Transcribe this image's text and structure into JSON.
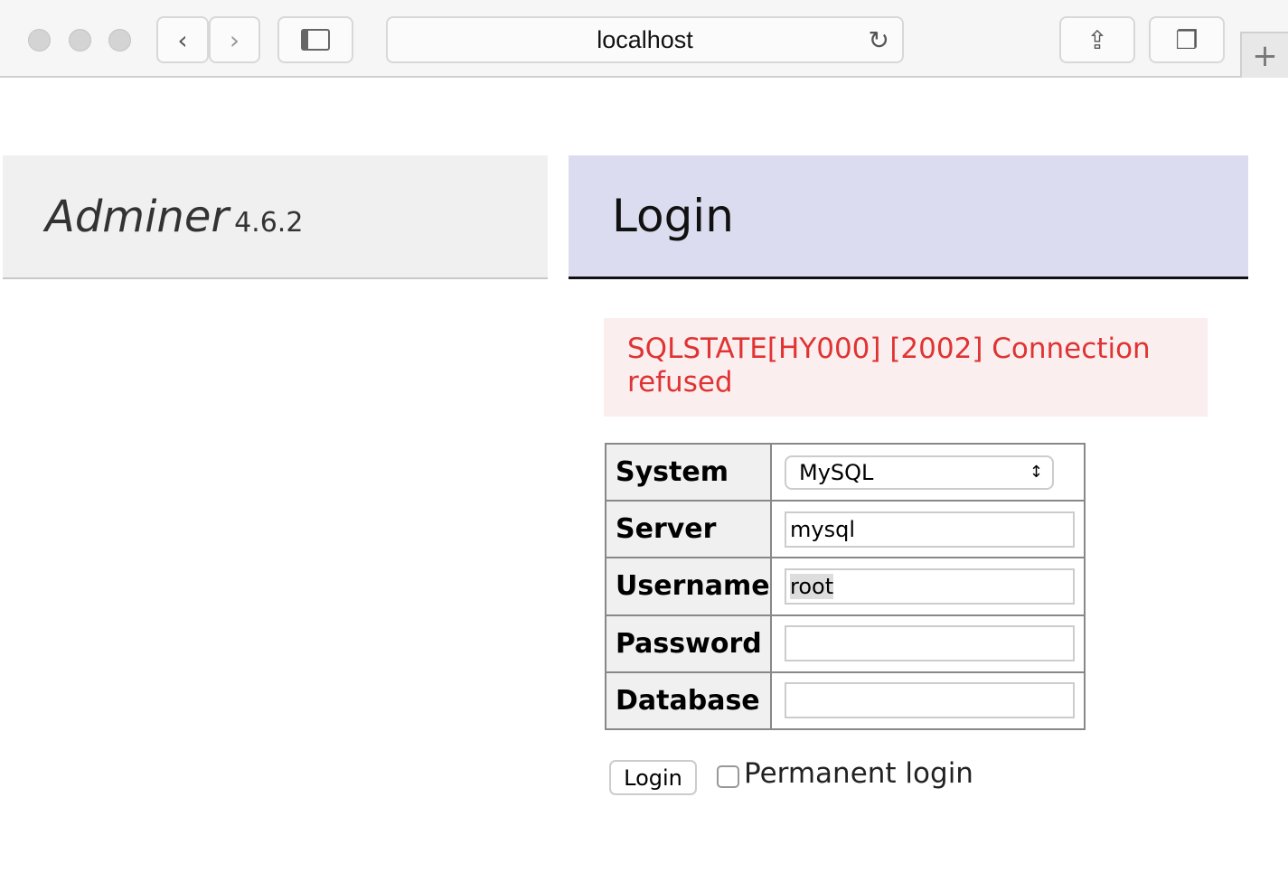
{
  "browser": {
    "url": "localhost",
    "icons": [
      "back-icon",
      "forward-icon",
      "sidebar-icon",
      "reload-icon",
      "share-icon",
      "tabs-icon",
      "plus-icon"
    ]
  },
  "brand": {
    "name": "Adminer",
    "version": "4.6.2"
  },
  "page": {
    "title": "Login"
  },
  "error": {
    "message": "SQLSTATE[HY000] [2002] Connection refused",
    "color": "#e03333"
  },
  "form": {
    "system": {
      "label": "System",
      "value": "MySQL"
    },
    "server": {
      "label": "Server",
      "value": "mysql"
    },
    "username": {
      "label": "Username",
      "value": "root"
    },
    "password": {
      "label": "Password",
      "value": ""
    },
    "database": {
      "label": "Database",
      "value": ""
    },
    "login_label": "Login",
    "permanent_label": "Permanent login"
  }
}
